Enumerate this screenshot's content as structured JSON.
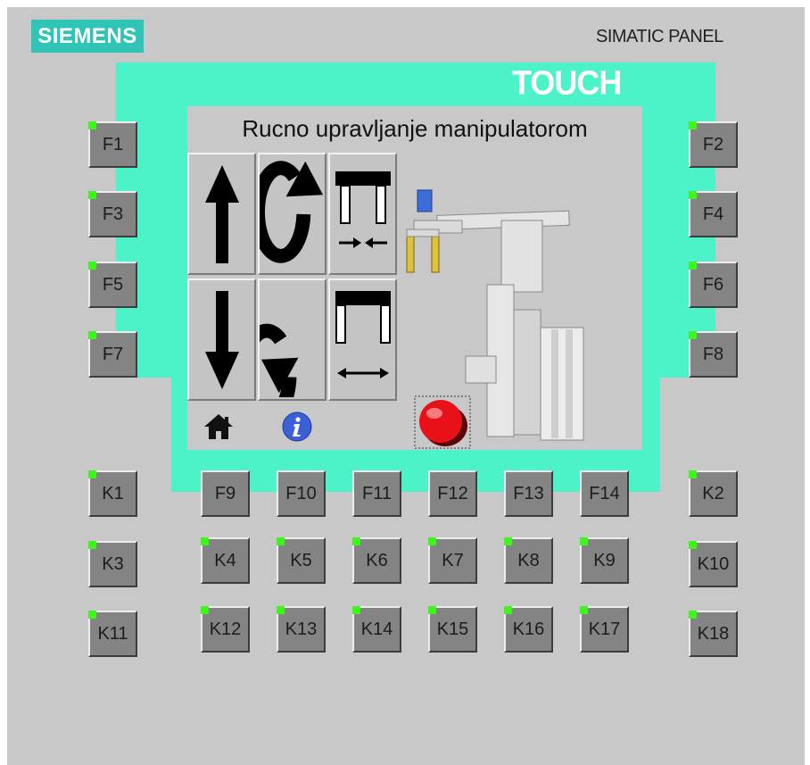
{
  "brand": {
    "logo": "SIEMENS",
    "model": "SIMATIC PANEL",
    "badge": "TOUCH"
  },
  "screen": {
    "title": "Rucno upravljanje manipulatorom",
    "controls": [
      {
        "name": "move-up-button",
        "icon": "arrow-up-icon"
      },
      {
        "name": "rotate-clockwise-button",
        "icon": "rotate-clockwise-icon"
      },
      {
        "name": "gripper-close-button",
        "icon": "gripper-close-icon"
      },
      {
        "name": "move-down-button",
        "icon": "arrow-down-icon"
      },
      {
        "name": "rotate-counterclockwise-button",
        "icon": "rotate-counterclockwise-icon"
      },
      {
        "name": "gripper-open-button",
        "icon": "gripper-open-icon"
      }
    ],
    "nav": [
      "home-icon",
      "info-icon",
      "emergency-stop-button"
    ]
  },
  "keys": {
    "left_column": [
      "F1",
      "F3",
      "F5",
      "F7"
    ],
    "right_column": [
      "F2",
      "F4",
      "F6",
      "F8"
    ],
    "row_f": [
      "K1",
      "F9",
      "F10",
      "F11",
      "F12",
      "F13",
      "F14",
      "K2"
    ],
    "row_k_top": [
      "K3",
      "K4",
      "K5",
      "K6",
      "K7",
      "K8",
      "K9",
      "K10"
    ],
    "row_k_bottom": [
      "K11",
      "K12",
      "K13",
      "K14",
      "K15",
      "K16",
      "K17",
      "K18"
    ]
  },
  "colors": {
    "bezel": "#4cf2c8",
    "panel": "#c8c8c8",
    "key": "#848484",
    "led": "#3ef51e",
    "logo": "#2ec4b6",
    "stop": "#e8111a"
  }
}
